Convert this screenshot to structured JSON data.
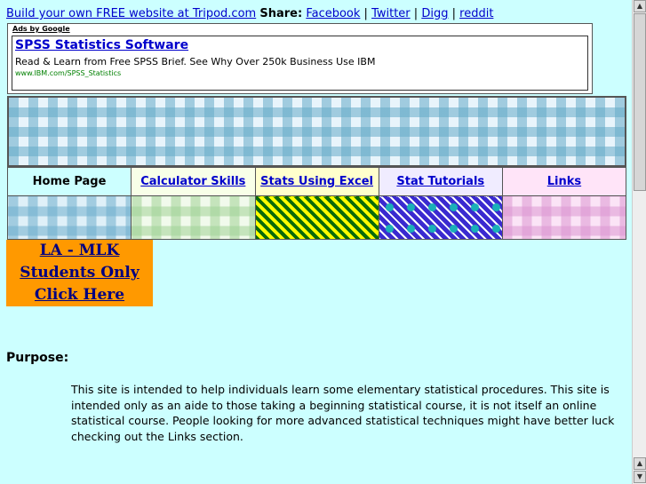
{
  "topbar": {
    "build_link": "Build your own FREE website at Tripod.com",
    "share_label": "Share:",
    "links": [
      "Facebook",
      "Twitter",
      "Digg",
      "reddit"
    ],
    "separator": "|"
  },
  "ad": {
    "ads_by": "Ads by Google",
    "title": "SPSS Statistics Software",
    "description": "Read & Learn from Free SPSS Brief. See Why Over 250k Business Use IBM",
    "url": "www.IBM.com/SPSS_Statistics"
  },
  "nav": {
    "items": [
      "Home Page",
      "Calculator Skills",
      "Stats Using Excel",
      "Stat Tutorials",
      "Links"
    ]
  },
  "promo": {
    "line1": "LA - MLK",
    "line2": "Students Only",
    "line3": "Click Here"
  },
  "purpose": {
    "heading": "Purpose:",
    "text": "This site is intended to help individuals learn some elementary statistical procedures. This site is intended only as an aide to those taking a beginning statistical course, it is not itself an online statistical course. People looking for more advanced statistical techniques might have better luck checking out the Links section."
  },
  "scrollbar": {
    "up": "▲",
    "down": "▼"
  }
}
